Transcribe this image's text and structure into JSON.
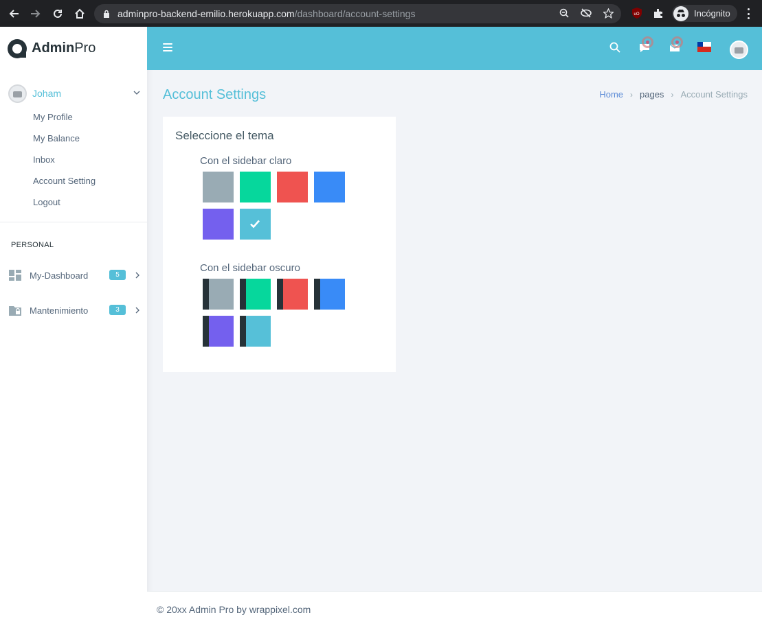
{
  "browser": {
    "url_domain": "adminpro-backend-emilio.herokuapp.com",
    "url_path": "/dashboard/account-settings",
    "incognito_label": "Incógnito"
  },
  "sidebar": {
    "logo_bold": "Admin",
    "logo_light": "Pro",
    "user_name": "Joham",
    "user_menu": [
      "My Profile",
      "My Balance",
      "Inbox",
      "Account Setting",
      "Logout"
    ],
    "section_label": "PERSONAL",
    "nav_items": [
      {
        "label": "My-Dashboard",
        "badge": "5",
        "icon": "dashboard-icon"
      },
      {
        "label": "Mantenimiento",
        "badge": "3",
        "icon": "folder-lock-icon"
      }
    ]
  },
  "topbar": {
    "icons": [
      "menu-icon",
      "search-icon",
      "comment-icon",
      "mail-icon",
      "chile-flag-icon",
      "avatar"
    ],
    "accent": "#55bfd8"
  },
  "page": {
    "title": "Account Settings",
    "breadcrumb": [
      "Home",
      "pages",
      "Account Settings"
    ]
  },
  "card": {
    "title": "Seleccione el tema",
    "light_label": "Con el sidebar claro",
    "dark_label": "Con el sidebar oscuro",
    "light_themes": [
      {
        "name": "default",
        "color": "#99abb4",
        "selected": false
      },
      {
        "name": "green",
        "color": "#06d79c",
        "selected": false
      },
      {
        "name": "red",
        "color": "#ef5350",
        "selected": false
      },
      {
        "name": "blue",
        "color": "#398bf7",
        "selected": false
      },
      {
        "name": "purple",
        "color": "#7460ee",
        "selected": false
      },
      {
        "name": "megna",
        "color": "#56c0d8",
        "selected": true
      }
    ],
    "dark_themes": [
      {
        "name": "default-dark",
        "color": "#99abb4",
        "selected": false
      },
      {
        "name": "green-dark",
        "color": "#06d79c",
        "selected": false
      },
      {
        "name": "red-dark",
        "color": "#ef5350",
        "selected": false
      },
      {
        "name": "blue-dark",
        "color": "#398bf7",
        "selected": false
      },
      {
        "name": "purple-dark",
        "color": "#7460ee",
        "selected": false
      },
      {
        "name": "megna-dark",
        "color": "#56c0d8",
        "selected": false
      }
    ]
  },
  "footer": {
    "text": "© 20xx Admin Pro by wrappixel.com"
  }
}
